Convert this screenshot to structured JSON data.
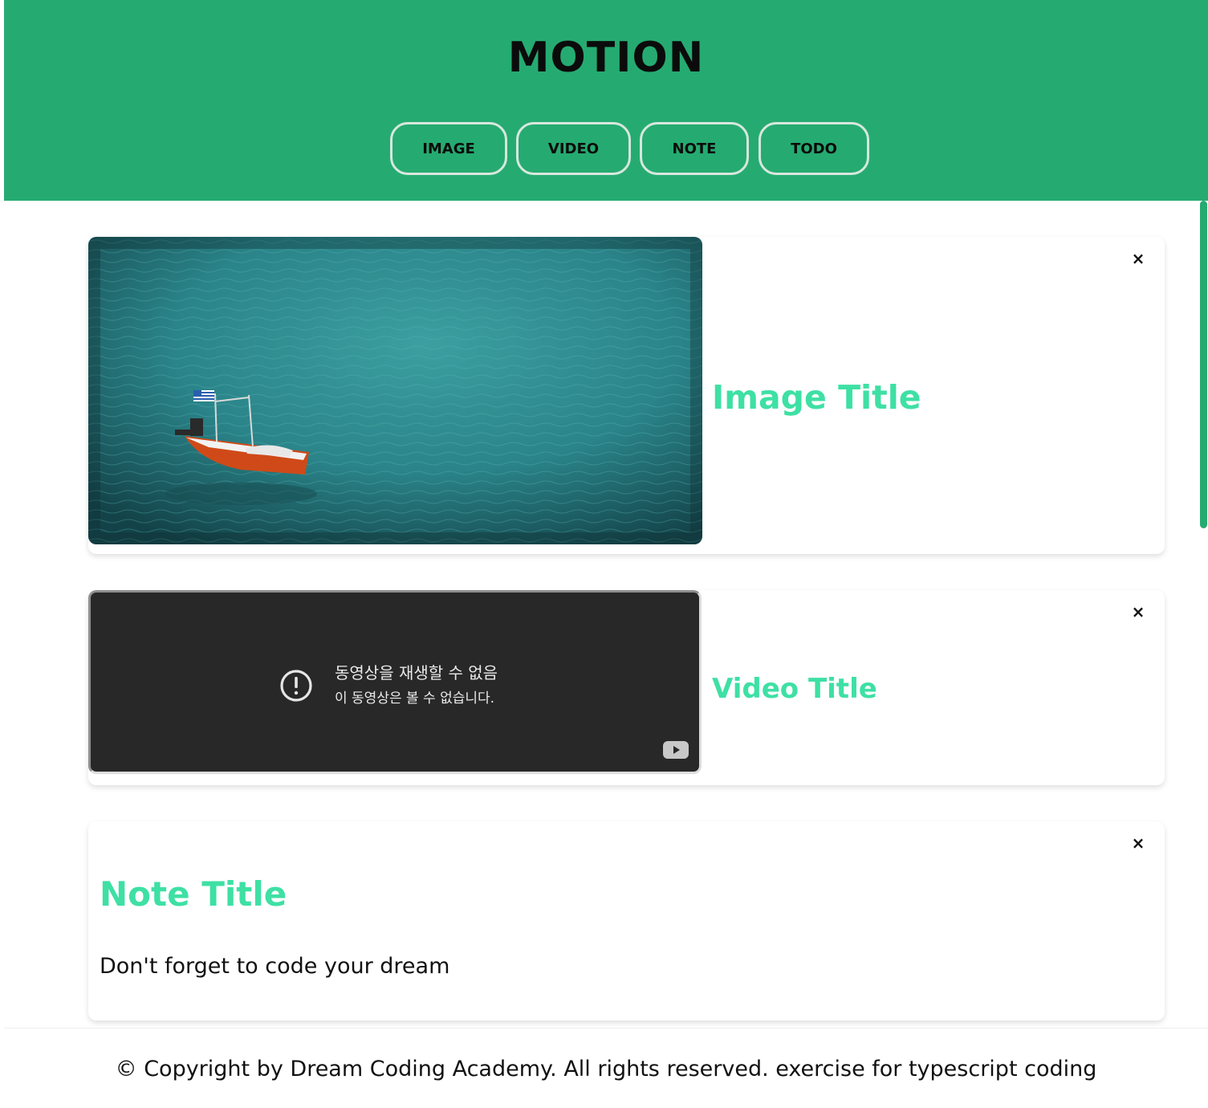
{
  "header": {
    "title": "MOTION",
    "buttons": {
      "image": "IMAGE",
      "video": "VIDEO",
      "note": "NOTE",
      "todo": "TODO"
    }
  },
  "cards": {
    "image": {
      "title": "Image Title",
      "close": "×"
    },
    "video": {
      "title": "Video Title",
      "close": "×",
      "error_title": "동영상을 재생할 수 없음",
      "error_subtitle": "이 동영상은 볼 수 없습니다."
    },
    "note": {
      "title": "Note Title",
      "body": "Don't forget to code your dream",
      "close": "×"
    }
  },
  "footer": {
    "text": "© Copyright by Dream Coding Academy. All rights reserved. exercise for typescript coding"
  },
  "colors": {
    "header_bg": "#25ab71",
    "title_accent": "#3ee0a4",
    "video_bg": "#282828"
  },
  "icons": [
    "close-icon",
    "error-icon",
    "youtube-icon",
    "boat-photo"
  ]
}
